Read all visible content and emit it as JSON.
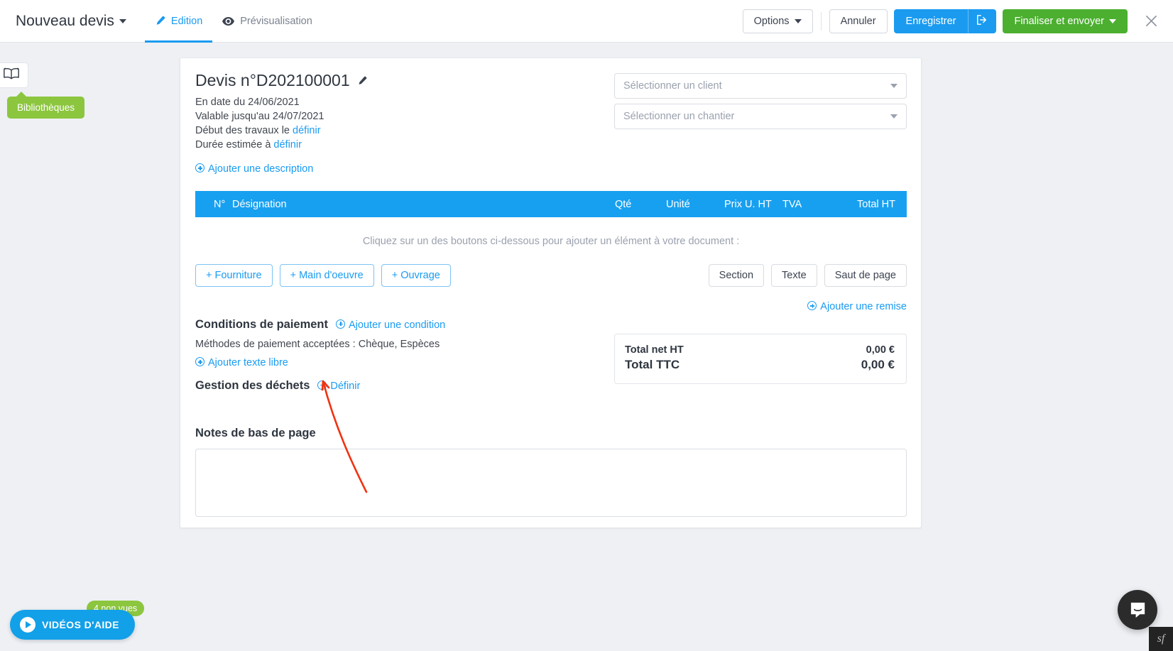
{
  "topbar": {
    "doc_title": "Nouveau devis",
    "tabs": [
      {
        "label": "Edition",
        "icon": "pencil-icon",
        "active": true
      },
      {
        "label": "Prévisualisation",
        "icon": "eye-icon",
        "active": false
      }
    ],
    "options_label": "Options",
    "cancel_label": "Annuler",
    "save_label": "Enregistrer",
    "save_exit_icon": "save-and-exit-icon",
    "finalize_label": "Finaliser et envoyer",
    "close_icon": "close-icon"
  },
  "sidebar": {
    "library_icon": "library-book-icon",
    "library_tooltip": "Bibliothèques"
  },
  "document": {
    "title": "Devis n°D202100001",
    "edit_icon": "pencil-icon",
    "date_line": "En date du 24/06/2021",
    "valid_line": "Valable jusqu'au 24/07/2021",
    "start_label": "Début des travaux le",
    "start_link": "définir",
    "duration_label": "Durée estimée à",
    "duration_link": "définir",
    "add_description": "Ajouter une description",
    "client_select_placeholder": "Sélectionner un client",
    "site_select_placeholder": "Sélectionner un chantier"
  },
  "table": {
    "headers": {
      "num": "N°",
      "designation": "Désignation",
      "qty": "Qté",
      "unit": "Unité",
      "unit_price": "Prix U. HT",
      "vat": "TVA",
      "total": "Total HT"
    },
    "rows": [],
    "empty_hint": "Cliquez sur un des boutons ci-dessous pour ajouter un élément à votre document :"
  },
  "actions": {
    "add_supply": "+ Fourniture",
    "add_labour": "+ Main d'oeuvre",
    "add_work": "+ Ouvrage",
    "section": "Section",
    "text": "Texte",
    "page_break": "Saut de page",
    "add_discount": "Ajouter une remise"
  },
  "payment": {
    "heading": "Conditions de paiement",
    "add_condition": "Ajouter une condition",
    "methods": "Méthodes de paiement acceptées : Chèque, Espèces",
    "add_free_text": "Ajouter texte libre"
  },
  "waste": {
    "heading": "Gestion des déchets",
    "define_link": "Définir"
  },
  "totals": {
    "net_ht_label": "Total net HT",
    "net_ht_value": "0,00 €",
    "ttc_label": "Total TTC",
    "ttc_value": "0,00 €"
  },
  "footer_notes": {
    "heading": "Notes de bas de page",
    "value": "",
    "placeholder": ""
  },
  "help": {
    "videos_label": "VIDÉOS D'AIDE",
    "unseen_badge": "4 non vues",
    "play_icon": "play-icon"
  },
  "widgets": {
    "intercom_icon": "chat-bubble-icon",
    "profiler_label": "sf"
  },
  "colors": {
    "accent_blue": "#1a9bf0",
    "table_header_blue": "#18a0f0",
    "green": "#4caf30",
    "tooltip_green": "#8cc63e",
    "annotation_red": "#f03311"
  }
}
